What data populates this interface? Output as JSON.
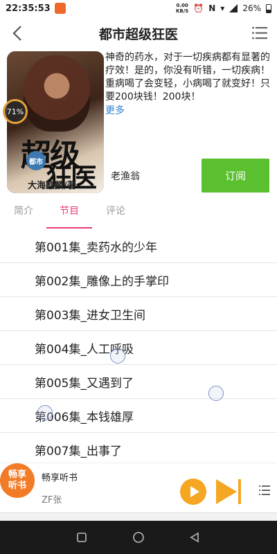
{
  "status": {
    "time": "22:35:53",
    "speed_value": "0.00",
    "speed_unit": "KB/S",
    "battery": "26%"
  },
  "header": {
    "title": "都市超级狂医"
  },
  "book": {
    "cover_title_line1": "超级",
    "cover_title_line2": "狂医",
    "cover_badge": "都市",
    "cover_author": "大海麒麟/著",
    "progress": "71%",
    "description": "神奇的药水，对于一切疾病都有显著的疗效！是的，你没有听错，一切疾病！重病喝了会变轻，小病喝了就变好！只要200块钱！200块！",
    "more": "更多",
    "narrator": "老渔翁",
    "subscribe": "订阅"
  },
  "tabs": [
    {
      "label": "简介"
    },
    {
      "label": "节目"
    },
    {
      "label": "评论"
    }
  ],
  "episodes": [
    "第001集_卖药水的少年",
    "第002集_雕像上的手掌印",
    "第003集_进女卫生间",
    "第004集_人工呼吸",
    "第005集_又遇到了",
    "第006集_本钱雄厚",
    "第007集_出事了"
  ],
  "player": {
    "logo_line1": "畅享",
    "logo_line2": "听书",
    "app_name": "畅享听书",
    "current": "ZF张"
  },
  "colors": {
    "accent": "#e6397a",
    "subscribe": "#5ac02f",
    "link": "#2a7fd4",
    "play": "#f5a623"
  }
}
